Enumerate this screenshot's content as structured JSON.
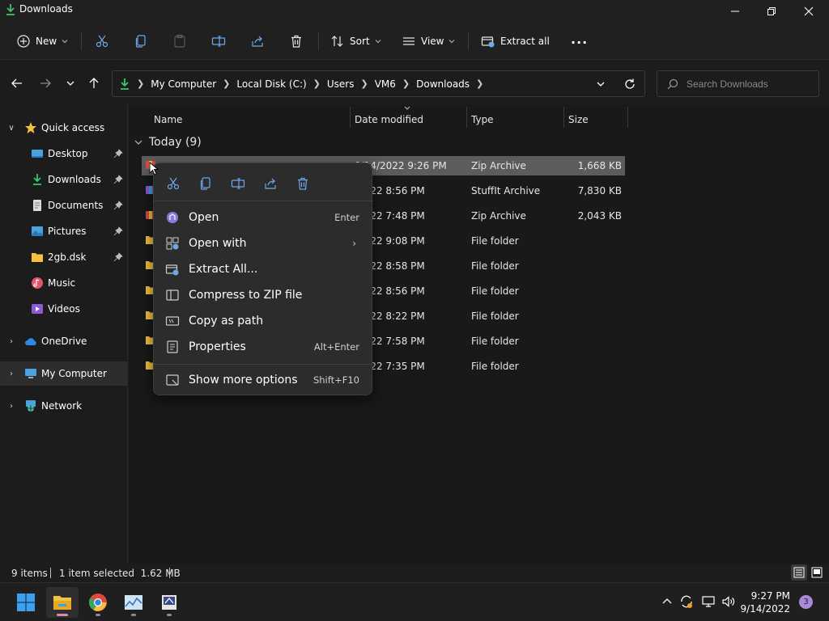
{
  "window": {
    "title": "Downloads"
  },
  "toolbar": {
    "new_label": "New",
    "sort_label": "Sort",
    "view_label": "View",
    "extract_all_label": "Extract all",
    "more_label": "..."
  },
  "address": {
    "crumbs": [
      "My Computer",
      "Local Disk (C:)",
      "Users",
      "VM6",
      "Downloads"
    ]
  },
  "search": {
    "placeholder": "Search Downloads"
  },
  "sidebar": {
    "quick_access": "Quick access",
    "items": [
      {
        "label": "Desktop",
        "icon": "desktop-icon",
        "pinned": true
      },
      {
        "label": "Downloads",
        "icon": "download-icon",
        "pinned": true
      },
      {
        "label": "Documents",
        "icon": "document-icon",
        "pinned": true
      },
      {
        "label": "Pictures",
        "icon": "picture-icon",
        "pinned": true
      },
      {
        "label": "2gb.dsk",
        "icon": "folder-icon",
        "pinned": true
      },
      {
        "label": "Music",
        "icon": "music-icon",
        "pinned": false
      },
      {
        "label": "Videos",
        "icon": "video-icon",
        "pinned": false
      }
    ],
    "onedrive": "OneDrive",
    "my_computer": "My Computer",
    "network": "Network"
  },
  "columns": {
    "name": "Name",
    "date": "Date modified",
    "type": "Type",
    "size": "Size"
  },
  "group": {
    "label": "Today (9)"
  },
  "files": [
    {
      "date": "9/14/2022 9:26 PM",
      "type": "Zip Archive",
      "size": "1,668 KB",
      "selected": true
    },
    {
      "date": "/2022 8:56 PM",
      "type": "StuffIt Archive",
      "size": "7,830 KB"
    },
    {
      "date": "/2022 7:48 PM",
      "type": "Zip Archive",
      "size": "2,043 KB"
    },
    {
      "date": "/2022 9:08 PM",
      "type": "File folder",
      "size": ""
    },
    {
      "date": "/2022 8:58 PM",
      "type": "File folder",
      "size": ""
    },
    {
      "date": "/2022 8:56 PM",
      "type": "File folder",
      "size": ""
    },
    {
      "date": "/2022 8:22 PM",
      "type": "File folder",
      "size": ""
    },
    {
      "date": "/2022 7:58 PM",
      "type": "File folder",
      "size": ""
    },
    {
      "date": "/2022 7:35 PM",
      "type": "File folder",
      "size": ""
    }
  ],
  "context_menu": {
    "items": [
      {
        "label": "Open",
        "shortcut": "Enter"
      },
      {
        "label": "Open with",
        "shortcut": ""
      },
      {
        "label": "Extract All...",
        "shortcut": ""
      },
      {
        "label": "Compress to ZIP file",
        "shortcut": ""
      },
      {
        "label": "Copy as path",
        "shortcut": ""
      },
      {
        "label": "Properties",
        "shortcut": "Alt+Enter"
      }
    ],
    "more": {
      "label": "Show more options",
      "shortcut": "Shift+F10"
    }
  },
  "status": {
    "items": "9 items",
    "selection": "1 item selected  1.62 MB"
  },
  "taskbar": {
    "time": "9:27 PM",
    "date": "9/14/2022",
    "notifications": "3"
  },
  "colors": {
    "background": "#191919",
    "selection": "#5c5c5c",
    "menu": "#2c2c2c",
    "download_green": "#3ec46d",
    "folder_yellow": "#f4c23f"
  }
}
